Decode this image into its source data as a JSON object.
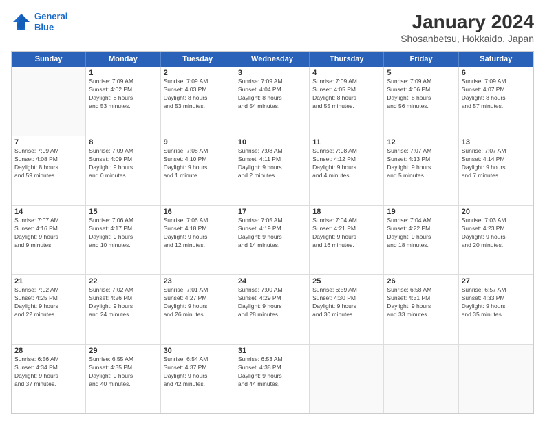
{
  "header": {
    "logo_line1": "General",
    "logo_line2": "Blue",
    "month_year": "January 2024",
    "location": "Shosanbetsu, Hokkaido, Japan"
  },
  "weekdays": [
    "Sunday",
    "Monday",
    "Tuesday",
    "Wednesday",
    "Thursday",
    "Friday",
    "Saturday"
  ],
  "rows": [
    [
      {
        "day": "",
        "text": ""
      },
      {
        "day": "1",
        "text": "Sunrise: 7:09 AM\nSunset: 4:02 PM\nDaylight: 8 hours\nand 53 minutes."
      },
      {
        "day": "2",
        "text": "Sunrise: 7:09 AM\nSunset: 4:03 PM\nDaylight: 8 hours\nand 53 minutes."
      },
      {
        "day": "3",
        "text": "Sunrise: 7:09 AM\nSunset: 4:04 PM\nDaylight: 8 hours\nand 54 minutes."
      },
      {
        "day": "4",
        "text": "Sunrise: 7:09 AM\nSunset: 4:05 PM\nDaylight: 8 hours\nand 55 minutes."
      },
      {
        "day": "5",
        "text": "Sunrise: 7:09 AM\nSunset: 4:06 PM\nDaylight: 8 hours\nand 56 minutes."
      },
      {
        "day": "6",
        "text": "Sunrise: 7:09 AM\nSunset: 4:07 PM\nDaylight: 8 hours\nand 57 minutes."
      }
    ],
    [
      {
        "day": "7",
        "text": "Sunrise: 7:09 AM\nSunset: 4:08 PM\nDaylight: 8 hours\nand 59 minutes."
      },
      {
        "day": "8",
        "text": "Sunrise: 7:09 AM\nSunset: 4:09 PM\nDaylight: 9 hours\nand 0 minutes."
      },
      {
        "day": "9",
        "text": "Sunrise: 7:08 AM\nSunset: 4:10 PM\nDaylight: 9 hours\nand 1 minute."
      },
      {
        "day": "10",
        "text": "Sunrise: 7:08 AM\nSunset: 4:11 PM\nDaylight: 9 hours\nand 2 minutes."
      },
      {
        "day": "11",
        "text": "Sunrise: 7:08 AM\nSunset: 4:12 PM\nDaylight: 9 hours\nand 4 minutes."
      },
      {
        "day": "12",
        "text": "Sunrise: 7:07 AM\nSunset: 4:13 PM\nDaylight: 9 hours\nand 5 minutes."
      },
      {
        "day": "13",
        "text": "Sunrise: 7:07 AM\nSunset: 4:14 PM\nDaylight: 9 hours\nand 7 minutes."
      }
    ],
    [
      {
        "day": "14",
        "text": "Sunrise: 7:07 AM\nSunset: 4:16 PM\nDaylight: 9 hours\nand 9 minutes."
      },
      {
        "day": "15",
        "text": "Sunrise: 7:06 AM\nSunset: 4:17 PM\nDaylight: 9 hours\nand 10 minutes."
      },
      {
        "day": "16",
        "text": "Sunrise: 7:06 AM\nSunset: 4:18 PM\nDaylight: 9 hours\nand 12 minutes."
      },
      {
        "day": "17",
        "text": "Sunrise: 7:05 AM\nSunset: 4:19 PM\nDaylight: 9 hours\nand 14 minutes."
      },
      {
        "day": "18",
        "text": "Sunrise: 7:04 AM\nSunset: 4:21 PM\nDaylight: 9 hours\nand 16 minutes."
      },
      {
        "day": "19",
        "text": "Sunrise: 7:04 AM\nSunset: 4:22 PM\nDaylight: 9 hours\nand 18 minutes."
      },
      {
        "day": "20",
        "text": "Sunrise: 7:03 AM\nSunset: 4:23 PM\nDaylight: 9 hours\nand 20 minutes."
      }
    ],
    [
      {
        "day": "21",
        "text": "Sunrise: 7:02 AM\nSunset: 4:25 PM\nDaylight: 9 hours\nand 22 minutes."
      },
      {
        "day": "22",
        "text": "Sunrise: 7:02 AM\nSunset: 4:26 PM\nDaylight: 9 hours\nand 24 minutes."
      },
      {
        "day": "23",
        "text": "Sunrise: 7:01 AM\nSunset: 4:27 PM\nDaylight: 9 hours\nand 26 minutes."
      },
      {
        "day": "24",
        "text": "Sunrise: 7:00 AM\nSunset: 4:29 PM\nDaylight: 9 hours\nand 28 minutes."
      },
      {
        "day": "25",
        "text": "Sunrise: 6:59 AM\nSunset: 4:30 PM\nDaylight: 9 hours\nand 30 minutes."
      },
      {
        "day": "26",
        "text": "Sunrise: 6:58 AM\nSunset: 4:31 PM\nDaylight: 9 hours\nand 33 minutes."
      },
      {
        "day": "27",
        "text": "Sunrise: 6:57 AM\nSunset: 4:33 PM\nDaylight: 9 hours\nand 35 minutes."
      }
    ],
    [
      {
        "day": "28",
        "text": "Sunrise: 6:56 AM\nSunset: 4:34 PM\nDaylight: 9 hours\nand 37 minutes."
      },
      {
        "day": "29",
        "text": "Sunrise: 6:55 AM\nSunset: 4:35 PM\nDaylight: 9 hours\nand 40 minutes."
      },
      {
        "day": "30",
        "text": "Sunrise: 6:54 AM\nSunset: 4:37 PM\nDaylight: 9 hours\nand 42 minutes."
      },
      {
        "day": "31",
        "text": "Sunrise: 6:53 AM\nSunset: 4:38 PM\nDaylight: 9 hours\nand 44 minutes."
      },
      {
        "day": "",
        "text": ""
      },
      {
        "day": "",
        "text": ""
      },
      {
        "day": "",
        "text": ""
      }
    ]
  ]
}
